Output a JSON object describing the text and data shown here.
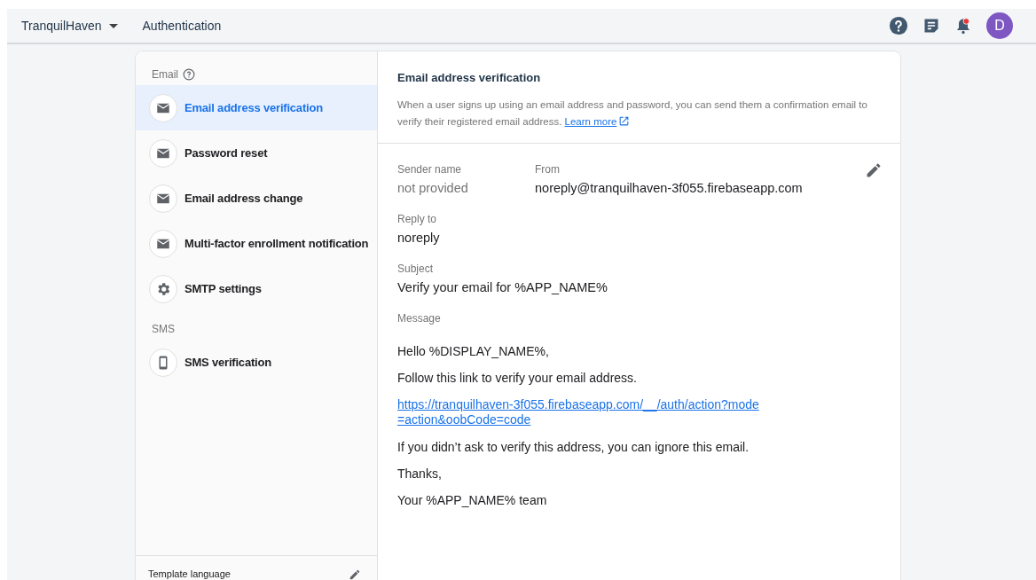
{
  "top_bar": {
    "project": "TranquilHaven",
    "section": "Authentication",
    "avatar_letter": "D",
    "notification_dot": true
  },
  "sidebar": {
    "groups": [
      {
        "label": "Email",
        "help": true,
        "items": [
          {
            "label": "Email address verification",
            "kind": "mail",
            "selected": true
          },
          {
            "label": "Password reset",
            "kind": "mail",
            "selected": false
          },
          {
            "label": "Email address change",
            "kind": "mail",
            "selected": false
          },
          {
            "label": "Multi-factor enrollment notification",
            "kind": "mail",
            "selected": false
          },
          {
            "label": "SMTP settings",
            "kind": "gear",
            "selected": false
          }
        ]
      },
      {
        "label": "SMS",
        "help": false,
        "items": [
          {
            "label": "SMS verification",
            "kind": "phone",
            "selected": false
          }
        ]
      }
    ],
    "footer": {
      "label": "Template language"
    }
  },
  "template": {
    "title": "Email address verification",
    "description": "When a user signs up using an email address and password, you can send them a confirmation email to verify their registered email address.",
    "learn_more": "Learn more",
    "sender_name": {
      "label": "Sender name",
      "placeholder": "not provided"
    },
    "from": {
      "label": "From",
      "value": "noreply@tranquilhaven-3f055.firebaseapp.com"
    },
    "reply_to": {
      "label": "Reply to",
      "value": "noreply"
    },
    "subject": {
      "label": "Subject",
      "value": "Verify your email for %APP_NAME%"
    },
    "message": {
      "label": "Message",
      "lines": [
        {
          "kind": "text",
          "text": "Hello %DISPLAY_NAME%,"
        },
        {
          "kind": "text",
          "text": "Follow this link to verify your email address."
        },
        {
          "kind": "link",
          "text": "https://tranquilhaven-3f055.firebaseapp.com/__/auth/action?mode=action&oobCode=code"
        },
        {
          "kind": "text",
          "text": "If you didn’t ask to verify this address, you can ignore this email."
        },
        {
          "kind": "text",
          "text": "Thanks,"
        },
        {
          "kind": "text",
          "text": "Your %APP_NAME% team"
        }
      ]
    }
  }
}
